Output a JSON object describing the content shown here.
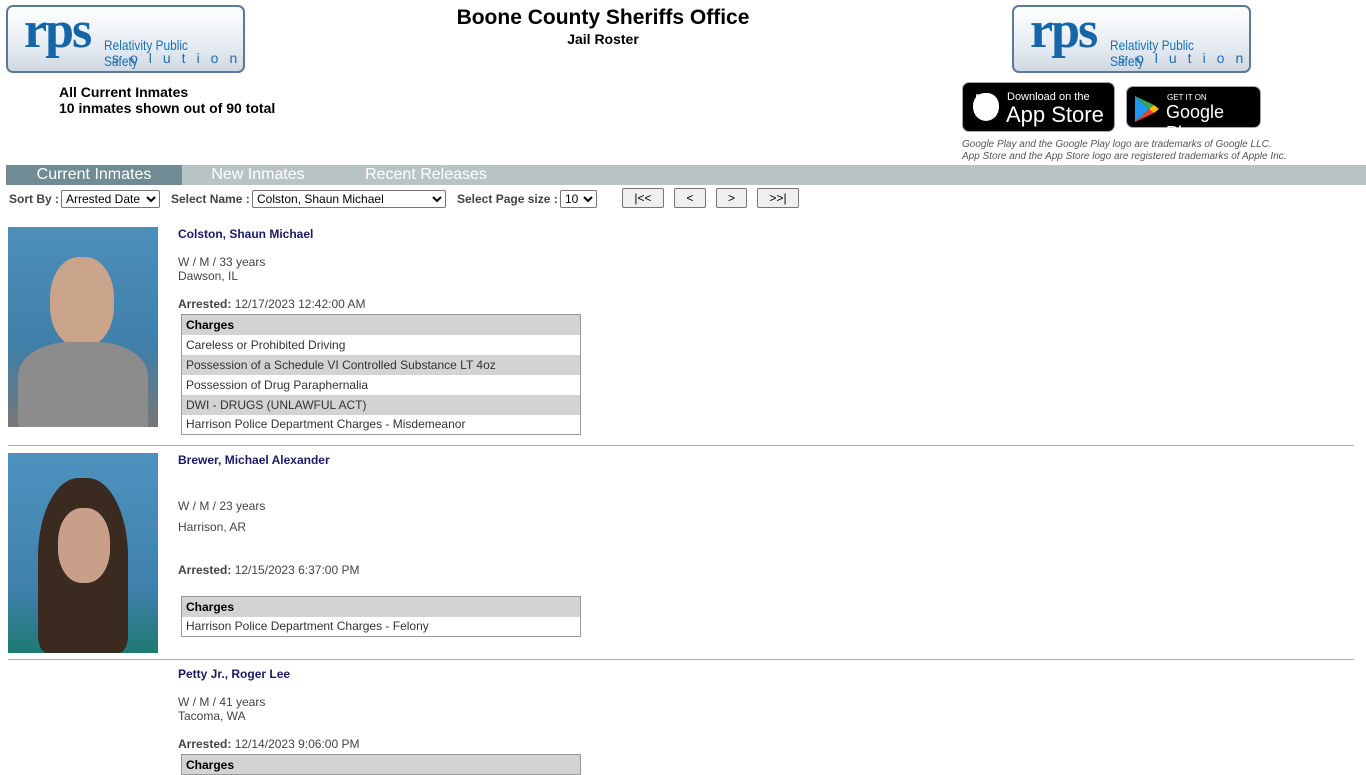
{
  "header": {
    "title": "Boone County Sheriffs Office",
    "subtitle": "Jail Roster",
    "logo_text": "rps",
    "logo_line1": "Relativity Public Safety",
    "logo_line2": "solutions"
  },
  "summary": {
    "heading": "All Current Inmates",
    "count": "10 inmates shown out of 90 total"
  },
  "stores": {
    "apple_small": "Download on the",
    "apple_big": "App Store",
    "google_small": "GET IT ON",
    "google_big": "Google Play",
    "trademark1": "Google Play and the Google Play logo are trademarks of Google LLC.",
    "trademark2": "App Store and the App Store logo are registered trademarks of Apple Inc."
  },
  "tabs": [
    {
      "label": "Current Inmates",
      "active": true
    },
    {
      "label": "New Inmates"
    },
    {
      "label": "Recent Releases"
    }
  ],
  "controls": {
    "sort_label": "Sort By :",
    "sort_value": "Arrested Date",
    "name_label": "Select Name :",
    "name_value": "Colston, Shaun Michael",
    "page_label": "Select Page size :",
    "page_value": "10",
    "first": "|<<",
    "prev": "<",
    "next": ">",
    "last": ">>|"
  },
  "inmates": [
    {
      "name": "Colston, Shaun Michael",
      "demo": "W / M / 33 years",
      "city": "Dawson, IL",
      "arrested_label": "Arrested:",
      "arrested": "12/17/2023 12:42:00 AM",
      "charges_header": "Charges",
      "charges": [
        "Careless or Prohibited Driving",
        "Possession of a Schedule VI Controlled Substance LT 4oz",
        "Possession of Drug Paraphernalia",
        "DWI - DRUGS (UNLAWFUL ACT)",
        "Harrison Police Department Charges - Misdemeanor"
      ]
    },
    {
      "name": "Brewer, Michael Alexander",
      "demo": "W / M / 23 years",
      "city": "Harrison, AR",
      "arrested_label": "Arrested:",
      "arrested": "12/15/2023 6:37:00 PM",
      "charges_header": "Charges",
      "charges": [
        "Harrison Police Department Charges - Felony"
      ]
    },
    {
      "name": "Petty Jr., Roger Lee",
      "demo": "W / M / 41 years",
      "city": "Tacoma, WA",
      "arrested_label": "Arrested:",
      "arrested": "12/14/2023 9:06:00 PM",
      "charges_header": "Charges",
      "charges": []
    }
  ]
}
